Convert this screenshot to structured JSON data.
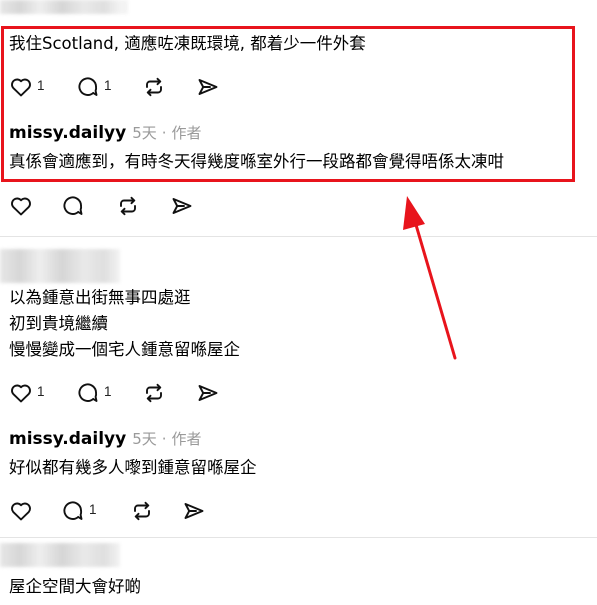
{
  "comments": [
    {
      "text": "我住Scotland, 適應咗凍既環境, 都着少一件外套",
      "likes": "1",
      "replies": "1"
    },
    {
      "author": "missy.dailyy",
      "time": "5天",
      "role": "作者",
      "text": "真係會適應到，有時冬天得幾度喺室外行一段路都會覺得唔係太凍咁"
    },
    {
      "lines": [
        "以為鍾意出街無事四處逛",
        "初到貴境繼續",
        "慢慢變成一個宅人鍾意留喺屋企"
      ],
      "likes": "1",
      "replies": "1"
    },
    {
      "author": "missy.dailyy",
      "time": "5天",
      "role": "作者",
      "text": "好似都有幾多人嚟到鍾意留喺屋企",
      "replies": "1"
    },
    {
      "text": "屋企空間大會好啲"
    }
  ],
  "icons": [
    "heart-icon",
    "comment-icon",
    "repost-icon",
    "share-icon"
  ],
  "colors": {
    "highlight": "#e8141c",
    "meta_gray": "#9a9a9a",
    "divider": "#e4e4e4"
  }
}
